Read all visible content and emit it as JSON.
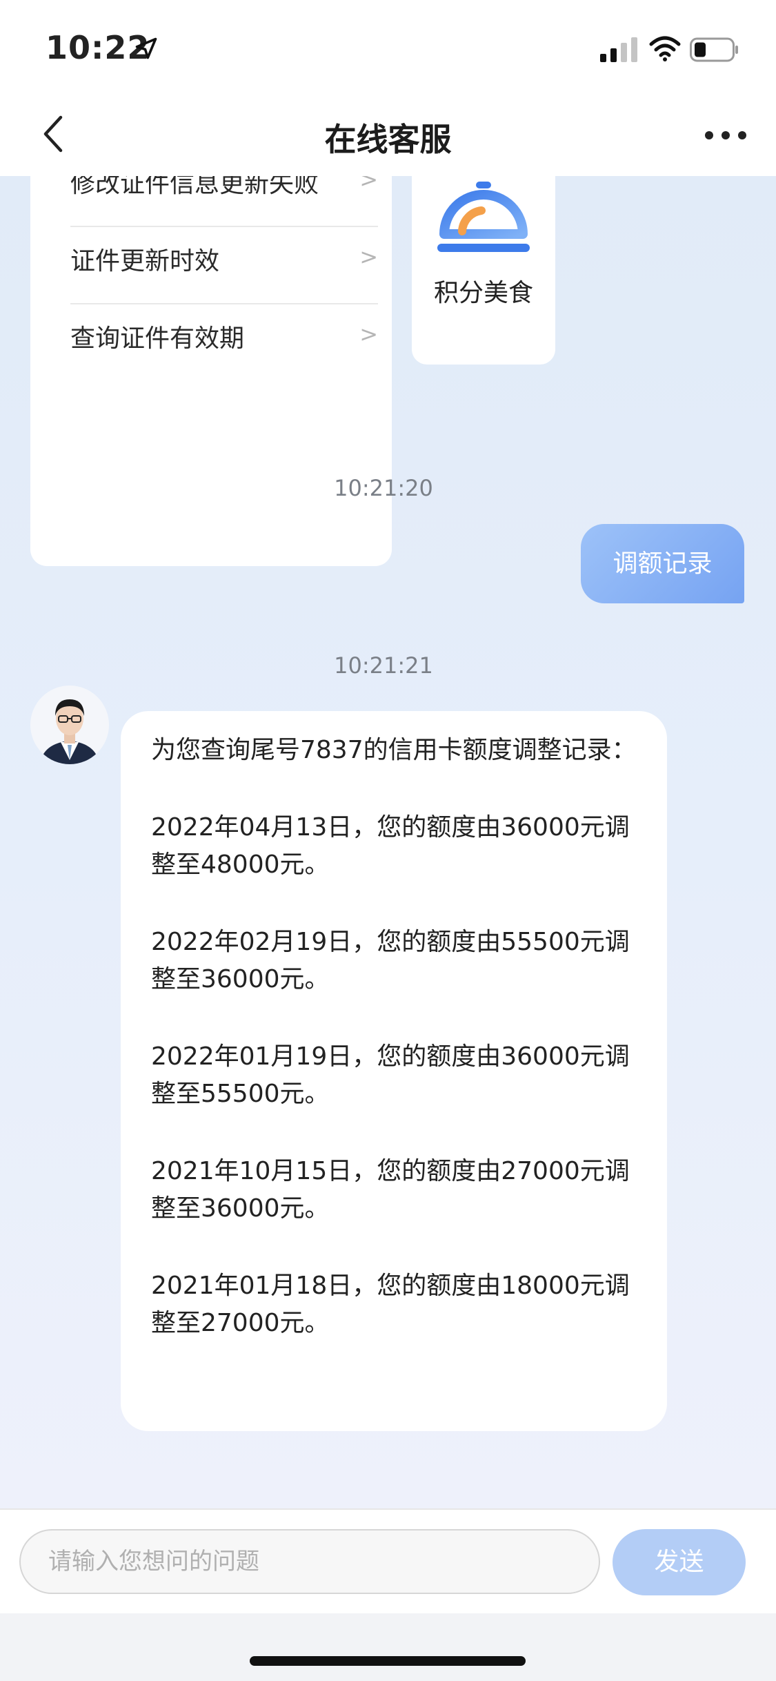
{
  "status_bar": {
    "time": "10:22"
  },
  "nav": {
    "title": "在线客服"
  },
  "faq_items": [
    {
      "label": "修改证件信息更新失败",
      "arrow": ">"
    },
    {
      "label": "证件更新时效",
      "arrow": ">"
    },
    {
      "label": "查询证件有效期",
      "arrow": ">"
    }
  ],
  "food_card": {
    "label": "积分美食"
  },
  "messages": {
    "ts1": "10:21:20",
    "user_msg": "调额记录",
    "ts2": "10:21:21",
    "bot_lines": [
      "为您查询尾号7837的信用卡额度调整记录：",
      "2022年04月13日，您的额度由36000元调整至48000元。",
      "2022年02月19日，您的额度由55500元调整至36000元。",
      "2022年01月19日，您的额度由36000元调整至55500元。",
      "2021年10月15日，您的额度由27000元调整至36000元。",
      "2021年01月18日，您的额度由18000元调整至27000元。"
    ]
  },
  "input": {
    "placeholder": "请输入您想问的问题",
    "value": ""
  },
  "send_label": "发送",
  "colors": {
    "accent": "#7aa6f3",
    "send_disabled": "#b3cdf6",
    "chat_bg": "#e4edf9"
  }
}
